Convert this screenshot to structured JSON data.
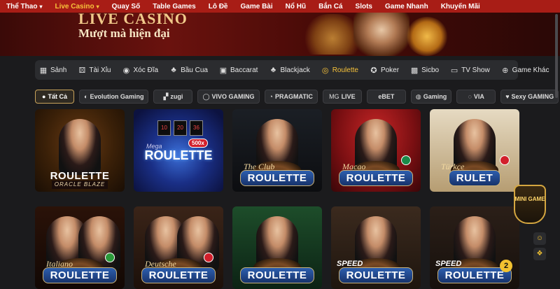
{
  "topnav": {
    "items": [
      {
        "label": "Thể Thao",
        "has_dropdown": true,
        "active": false
      },
      {
        "label": "Live Casino",
        "has_dropdown": true,
        "active": true
      },
      {
        "label": "Quay Số",
        "has_dropdown": false,
        "active": false
      },
      {
        "label": "Table Games",
        "has_dropdown": false,
        "active": false
      },
      {
        "label": "Lô Đề",
        "has_dropdown": false,
        "active": false
      },
      {
        "label": "Game Bài",
        "has_dropdown": false,
        "active": false
      },
      {
        "label": "Nổ Hũ",
        "has_dropdown": false,
        "active": false
      },
      {
        "label": "Bắn Cá",
        "has_dropdown": false,
        "active": false
      },
      {
        "label": "Slots",
        "has_dropdown": false,
        "active": false
      },
      {
        "label": "Game Nhanh",
        "has_dropdown": false,
        "active": false
      },
      {
        "label": "Khuyến Mãi",
        "has_dropdown": false,
        "active": false
      }
    ],
    "chevron": "▾",
    "active_color": "#f7c23a",
    "bg_color": "#a81d16"
  },
  "banner": {
    "title": "LIVE CASINO",
    "subtitle": "Mượt mà hiện đại"
  },
  "categories": [
    {
      "label": "Sảnh",
      "icon": "grid-icon",
      "glyph": "▦"
    },
    {
      "label": "Tài Xỉu",
      "icon": "dice-icon",
      "glyph": "⚄"
    },
    {
      "label": "Xóc Đĩa",
      "icon": "plate-icon",
      "glyph": "◉"
    },
    {
      "label": "Bầu Cua",
      "icon": "gourd-icon",
      "glyph": "♣"
    },
    {
      "label": "Baccarat",
      "icon": "cards-icon",
      "glyph": "▣"
    },
    {
      "label": "Blackjack",
      "icon": "club-icon",
      "glyph": "♣"
    },
    {
      "label": "Roulette",
      "icon": "roulette-icon",
      "glyph": "◎",
      "active": true
    },
    {
      "label": "Poker",
      "icon": "poker-chip-icon",
      "glyph": "✪"
    },
    {
      "label": "Sicbo",
      "icon": "sicbo-icon",
      "glyph": "▩"
    },
    {
      "label": "TV Show",
      "icon": "tv-icon",
      "glyph": "▭"
    },
    {
      "label": "Game Khác",
      "icon": "gamepad-icon",
      "glyph": "⊕"
    }
  ],
  "providers": [
    {
      "label": "Tất Cả",
      "icon": "all-icon",
      "glyph": "●",
      "active": true
    },
    {
      "label": "Evolution Gaming",
      "icon": "evolution-logo",
      "glyph": "◐"
    },
    {
      "label": "zugi",
      "icon": "zugi-logo",
      "glyph": "▞"
    },
    {
      "label": "VIVO GAMING",
      "icon": "vivo-logo",
      "glyph": "◯"
    },
    {
      "label": "PRAGMATIC",
      "icon": "pragmatic-logo",
      "glyph": "◔"
    },
    {
      "label": "LIVE",
      "icon": "mg-live-logo",
      "glyph": "MG"
    },
    {
      "label": "eBET",
      "icon": "ebet-logo",
      "glyph": ""
    },
    {
      "label": "Gaming",
      "icon": "og-gaming-logo",
      "glyph": "◍"
    },
    {
      "label": "VIA",
      "icon": "via-logo",
      "glyph": "◌"
    },
    {
      "label": "Sexy GAMING",
      "icon": "sexy-gaming-logo",
      "glyph": "♥"
    }
  ],
  "games_row1": [
    {
      "title": "ROULETTE",
      "sub": "ORACLE BLAZE",
      "style": "oracle"
    },
    {
      "title": "ROULETTE",
      "sub": "Mega",
      "badge": "500x",
      "slots": [
        "10",
        "20",
        "36"
      ],
      "style": "mega"
    },
    {
      "title": "ROULETTE",
      "sub": "The Club",
      "style": "club"
    },
    {
      "title": "ROULETTE",
      "sub": "Macao",
      "style": "macao"
    },
    {
      "title": "RULET",
      "sub": "Türkçe",
      "style": "turkce"
    }
  ],
  "games_row2": [
    {
      "title": "ROULETTE",
      "sub": "Italiano",
      "style": "italiano"
    },
    {
      "title": "ROULETTE",
      "sub": "Deutsche",
      "style": "deutsche"
    },
    {
      "title": "ROULETTE",
      "sub": "",
      "style": "green"
    },
    {
      "title": "ROULETTE",
      "sub": "SPEED",
      "style": "speed1"
    },
    {
      "title": "ROULETTE",
      "sub": "SPEED",
      "number": "2",
      "style": "speed2"
    }
  ],
  "side": {
    "mini_game_label": "MINI GAME",
    "chat_glyph": "☺",
    "gift_glyph": "❖"
  }
}
